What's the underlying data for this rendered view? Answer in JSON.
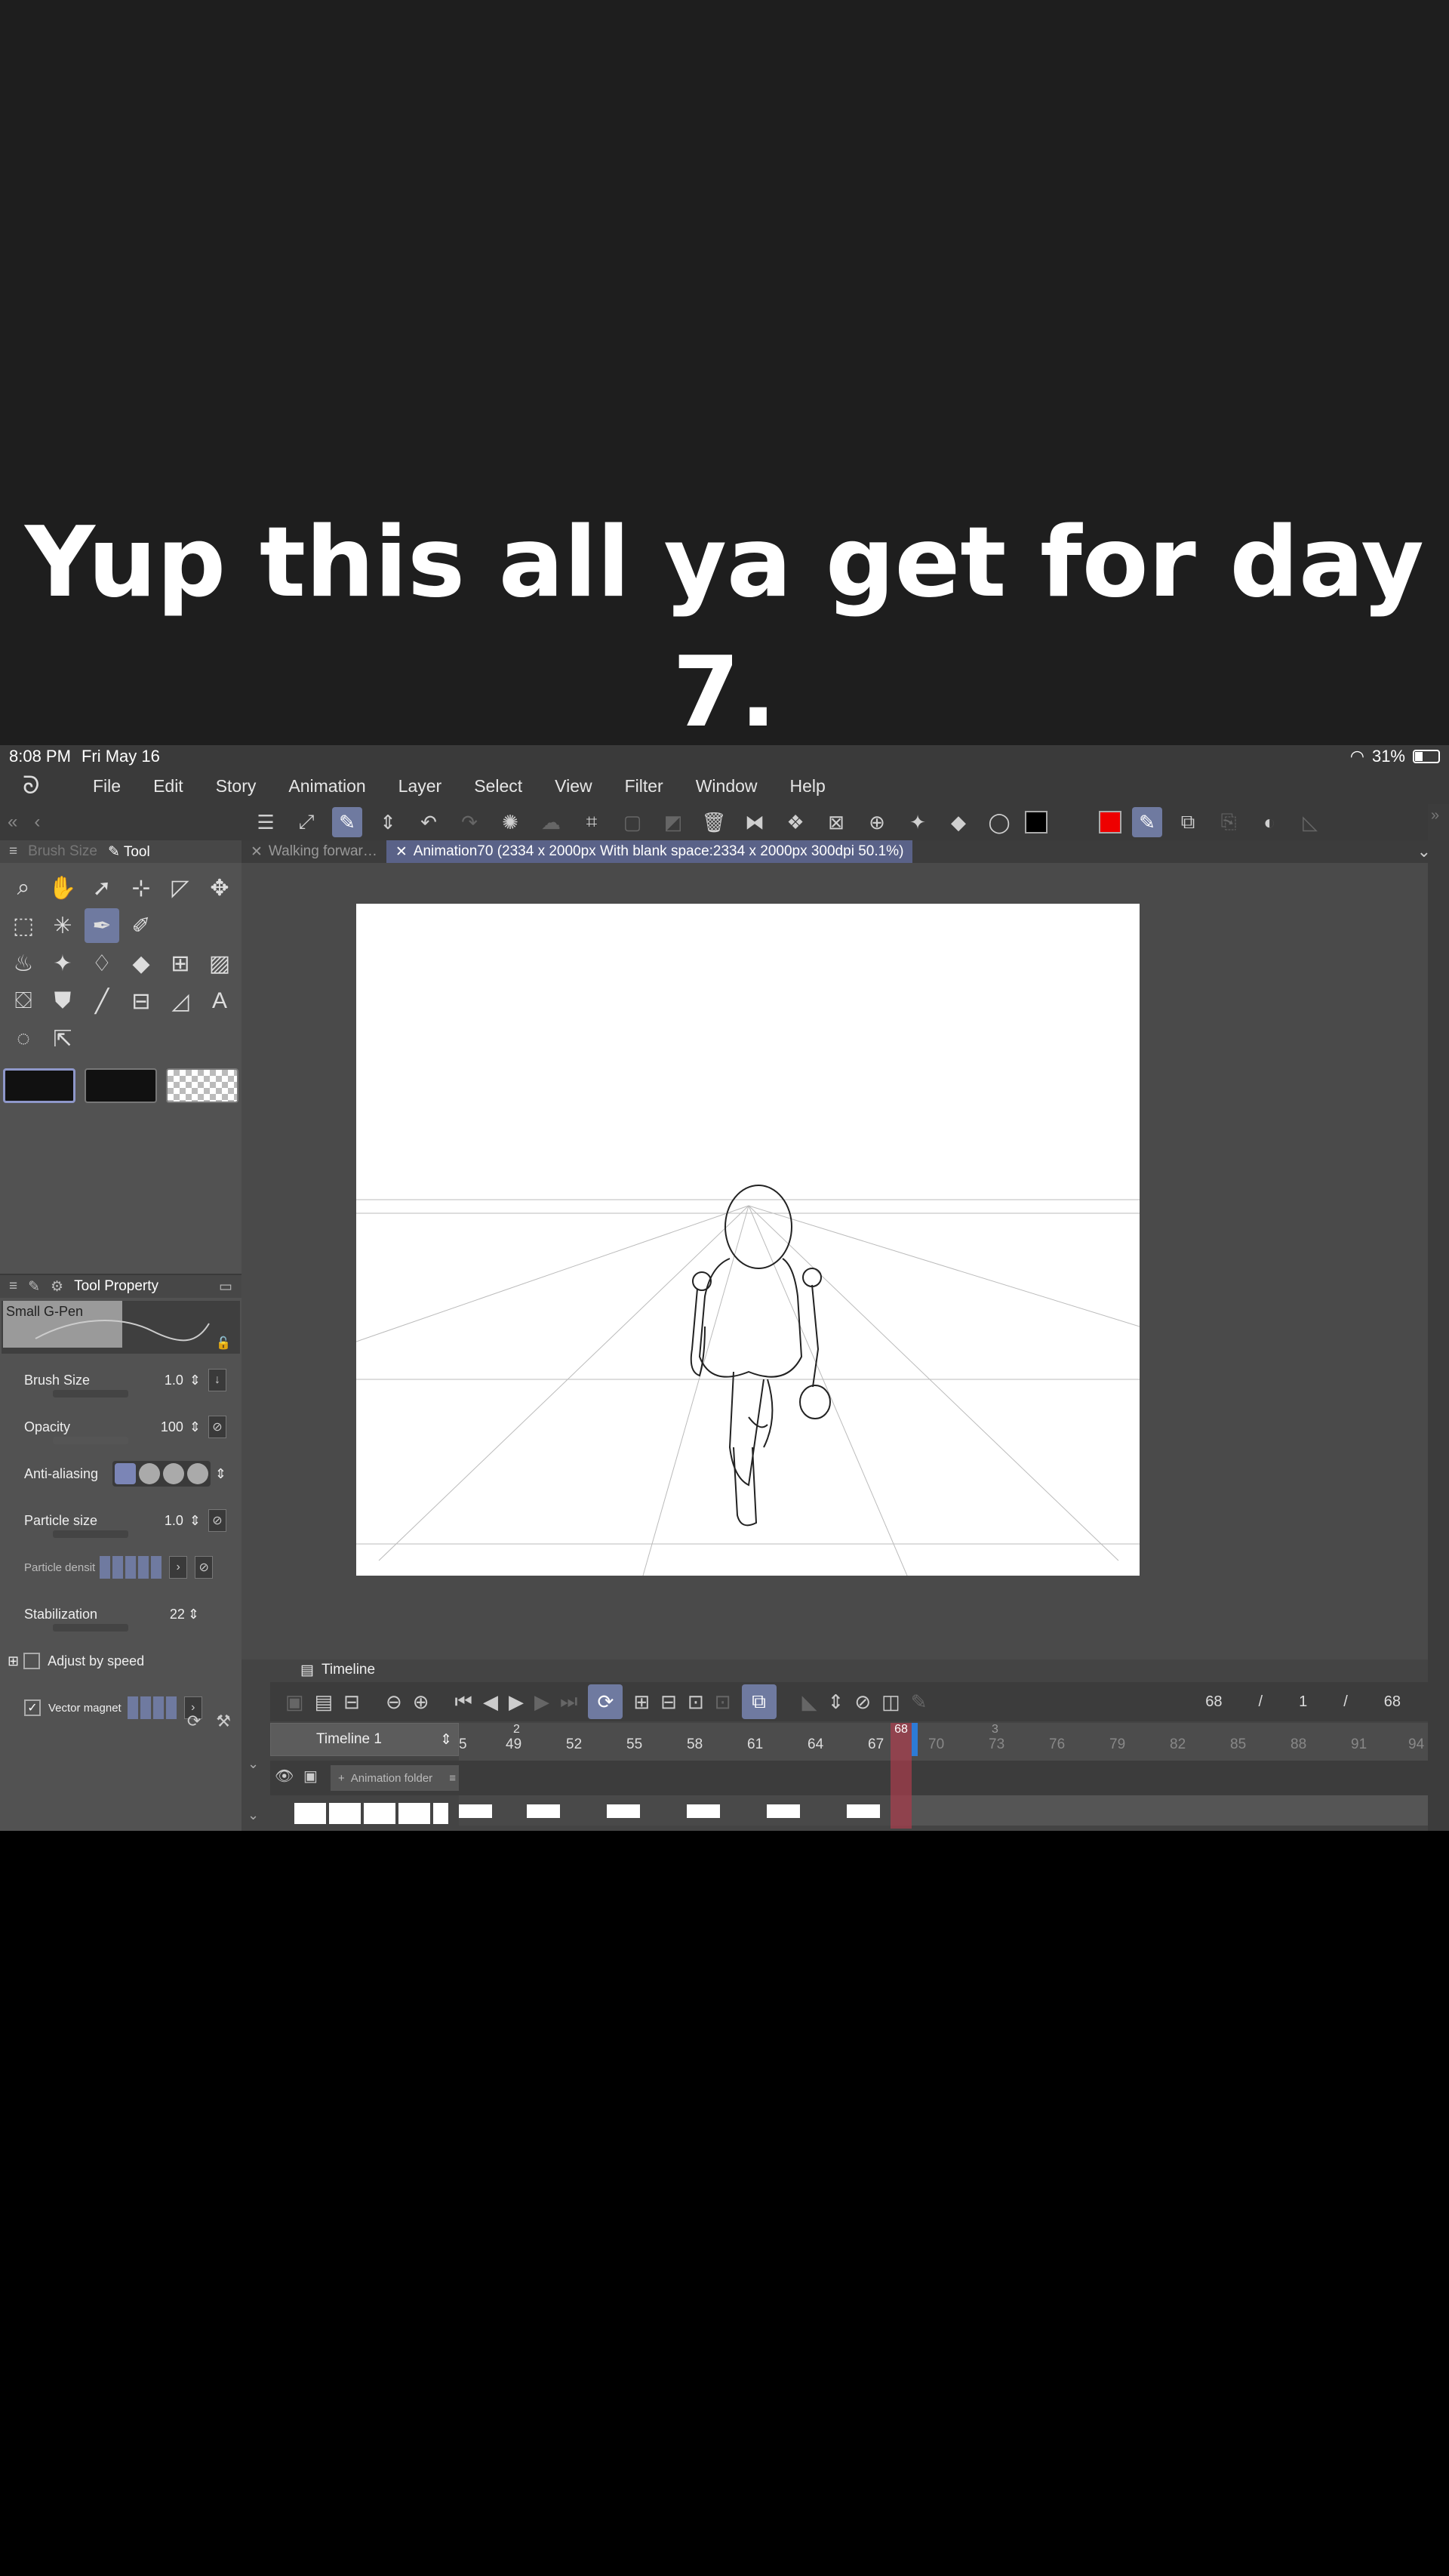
{
  "caption": {
    "text": "Yup this all ya get for day 7."
  },
  "status_bar": {
    "time": "8:08 PM",
    "date": "Fri May 16",
    "battery": "31%",
    "battery_level": 0.31
  },
  "menu": {
    "items": [
      "File",
      "Edit",
      "Story",
      "Animation",
      "Layer",
      "Select",
      "View",
      "Filter",
      "Window",
      "Help"
    ]
  },
  "tabs": [
    {
      "label": "Walking forwar…"
    },
    {
      "label": "Animation70 (2334 x 2000px With blank space:2334 x 2000px 300dpi 50.1%)"
    }
  ],
  "left_panel": {
    "tab_brush_size": "Brush Size",
    "tab_tool": "Tool"
  },
  "tool_property": {
    "title": "Tool Property",
    "brush_name": "Small G-Pen",
    "brush_size_label": "Brush Size",
    "brush_size_value": "1.0",
    "opacity_label": "Opacity",
    "opacity_value": "100",
    "antialiasing_label": "Anti-aliasing",
    "particle_size_label": "Particle size",
    "particle_size_value": "1.0",
    "particle_density_label": "Particle densit",
    "stabilization_label": "Stabilization",
    "stabilization_value": "22",
    "adjust_by_speed_label": "Adjust by speed",
    "vector_magnet_label": "Vector magnet"
  },
  "timeline": {
    "panel_title": "Timeline",
    "name": "Timeline 1",
    "current_frame": "68",
    "sep1": "/",
    "start": "1",
    "sep2": "/",
    "end": "68",
    "folder_label": "Animation folder",
    "ruler_ticks": [
      "5",
      "49",
      "52",
      "55",
      "58",
      "61",
      "64",
      "67",
      "70",
      "73",
      "76",
      "79",
      "82",
      "85",
      "88",
      "91",
      "94"
    ],
    "ruler_marker_2": "2",
    "ruler_marker_3": "3",
    "playhead_label": "68"
  },
  "colors": {
    "accent": "#6f7aa0",
    "main_color": "#000000",
    "sub_color": "#e00000",
    "playhead": "#c83c50"
  }
}
